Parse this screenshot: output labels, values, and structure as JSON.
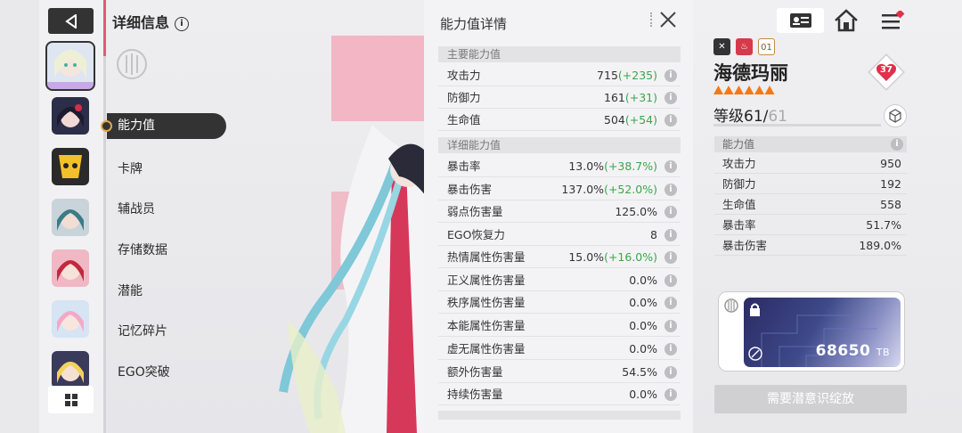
{
  "nav": {
    "title": "详细信息",
    "items": [
      "能力值",
      "卡牌",
      "辅战员",
      "存储数据",
      "潜能",
      "记忆碎片",
      "EGO突破"
    ],
    "active_index": 0
  },
  "detail": {
    "title": "能力值详情",
    "main_section": "主要能力值",
    "main_rows": [
      {
        "label": "攻击力",
        "value": "715",
        "bonus": "(+235)"
      },
      {
        "label": "防御力",
        "value": "161",
        "bonus": "(+31)"
      },
      {
        "label": "生命值",
        "value": "504",
        "bonus": "(+54)"
      }
    ],
    "detail_section": "详细能力值",
    "detail_rows": [
      {
        "label": "暴击率",
        "value": "13.0%",
        "bonus": "(+38.7%)"
      },
      {
        "label": "暴击伤害",
        "value": "137.0%",
        "bonus": "(+52.0%)"
      },
      {
        "label": "弱点伤害量",
        "value": "125.0%",
        "bonus": ""
      },
      {
        "label": "EGO恢复力",
        "value": "8",
        "bonus": ""
      },
      {
        "label": "热情属性伤害量",
        "value": "15.0%",
        "bonus": "(+16.0%)"
      },
      {
        "label": "正义属性伤害量",
        "value": "0.0%",
        "bonus": ""
      },
      {
        "label": "秩序属性伤害量",
        "value": "0.0%",
        "bonus": ""
      },
      {
        "label": "本能属性伤害量",
        "value": "0.0%",
        "bonus": ""
      },
      {
        "label": "虚无属性伤害量",
        "value": "0.0%",
        "bonus": ""
      },
      {
        "label": "额外伤害量",
        "value": "54.5%",
        "bonus": ""
      },
      {
        "label": "持续伤害量",
        "value": "0.0%",
        "bonus": ""
      }
    ]
  },
  "character": {
    "name": "海德玛丽",
    "badge_number": "01",
    "stars": 6,
    "level_label": "等级61/",
    "level_max": "61",
    "affection": "37"
  },
  "stats": {
    "section": "能力值",
    "rows": [
      {
        "label": "攻击力",
        "value": "950"
      },
      {
        "label": "防御力",
        "value": "192"
      },
      {
        "label": "生命值",
        "value": "558"
      },
      {
        "label": "暴击率",
        "value": "51.7%"
      },
      {
        "label": "暴击伤害",
        "value": "189.0%"
      }
    ]
  },
  "slot": {
    "value": "68650",
    "unit": "TB"
  },
  "unlock_button": "需要潜意识绽放",
  "icons": {
    "back": "back-arrow-icon",
    "grid": "grid-icon",
    "info": "info-icon",
    "close": "close-icon",
    "home": "home-icon",
    "menu": "menu-icon",
    "profile": "profile-card-icon"
  },
  "colors": {
    "accent_pink": "#e4587a",
    "bonus_green": "#3aa64a",
    "star_orange": "#f07a1a",
    "dark": "#333333"
  }
}
